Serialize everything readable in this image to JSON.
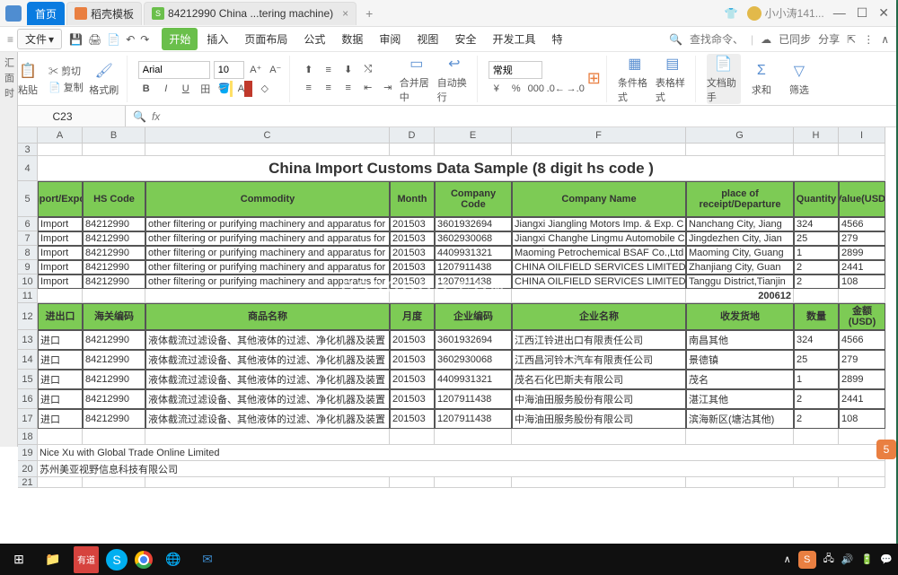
{
  "titlebar": {
    "home_tab": "首页",
    "template_tab": "稻壳模板",
    "doc_tab": "84212990 China ...tering machine)",
    "user": "小小涛141..."
  },
  "menubar": {
    "file": "文件",
    "tabs": [
      "开始",
      "插入",
      "页面布局",
      "公式",
      "数据",
      "审阅",
      "视图",
      "安全",
      "开发工具",
      "特"
    ],
    "search_ph": "查找命令、搜索模板",
    "synced": "已同步",
    "share": "分享"
  },
  "ribbon": {
    "paste": "粘贴",
    "copy": "复制",
    "brush": "格式刷",
    "cut": "剪切",
    "font": "Arial",
    "size": "10",
    "merge": "合并居中",
    "wrap": "自动换行",
    "numfmt": "常规",
    "cond": "条件格式",
    "cellstyle": "表格样式",
    "asst": "文档助手",
    "sum": "求和",
    "filter": "筛选"
  },
  "formula": {
    "namebox": "C23"
  },
  "sheet": {
    "cols_letters": [
      "A",
      "B",
      "C",
      "D",
      "E",
      "F",
      "G",
      "H",
      "I"
    ],
    "title": "China Import Customs Data Sample (8 digit hs code )",
    "headers_en": [
      "Import/Export",
      "HS Code",
      "Commodity",
      "Month",
      "Company Code",
      "Company Name",
      "place of receipt/Departure",
      "Quantity",
      "Value(USD)"
    ],
    "headers_cn": [
      "进出口",
      "海关编码",
      "商品名称",
      "月度",
      "企业编码",
      "企业名称",
      "收发货地",
      "数量",
      "金额(USD)"
    ],
    "rows_en": [
      [
        "Import",
        "84212990",
        "other filtering or purifying machinery and apparatus for liq",
        "201503",
        "3601932694",
        "Jiangxi Jiangling Motors Imp. & Exp. C",
        "Nanchang City, Jiang",
        "324",
        "4566"
      ],
      [
        "Import",
        "84212990",
        "other filtering or purifying machinery and apparatus for liq",
        "201503",
        "3602930068",
        "Jiangxi Changhe Lingmu Automobile C",
        "Jingdezhen City, Jian",
        "25",
        "279"
      ],
      [
        "Import",
        "84212990",
        "other filtering or purifying machinery and apparatus for liq",
        "201503",
        "4409931321",
        "Maoming Petrochemical BSAF Co.,Ltd",
        "Maoming City, Guang",
        "1",
        "2899"
      ],
      [
        "Import",
        "84212990",
        "other filtering or purifying machinery and apparatus for liq",
        "201503",
        "1207911438",
        "CHINA OILFIELD SERVICES LIMITED",
        "Zhanjiang City, Guan",
        "2",
        "2441"
      ],
      [
        "Import",
        "84212990",
        "other filtering or purifying machinery and apparatus for liq",
        "201503",
        "1207911438",
        "CHINA OILFIELD SERVICES LIMITED",
        "Tanggu District,Tianjin",
        "2",
        "108"
      ]
    ],
    "extra_g11": "200612",
    "rows_cn": [
      [
        "进口",
        "84212990",
        "液体截流过滤设备、其他液体的过滤、净化机器及装置",
        "201503",
        "3601932694",
        "江西江铃进出口有限责任公司",
        "南昌其他",
        "324",
        "4566"
      ],
      [
        "进口",
        "84212990",
        "液体截流过滤设备、其他液体的过滤、净化机器及装置",
        "201503",
        "3602930068",
        "江西昌河铃木汽车有限责任公司",
        "景德镇",
        "25",
        "279"
      ],
      [
        "进口",
        "84212990",
        "液体截流过滤设备、其他液体的过滤、净化机器及装置",
        "201503",
        "4409931321",
        "茂名石化巴斯夫有限公司",
        "茂名",
        "1",
        "2899"
      ],
      [
        "进口",
        "84212990",
        "液体截流过滤设备、其他液体的过滤、净化机器及装置",
        "201503",
        "1207911438",
        "中海油田服务股份有限公司",
        "湛江其他",
        "2",
        "2441"
      ],
      [
        "进口",
        "84212990",
        "液体截流过滤设备、其他液体的过滤、净化机器及装置",
        "201503",
        "1207911438",
        "中海油田服务股份有限公司",
        "滨海新区(塘沽其他)",
        "2",
        "108"
      ]
    ],
    "footer1": "Nice Xu with Global Trade Online Limited",
    "footer2": "苏州美亚视野信息科技有限公司"
  },
  "chart_data": {
    "type": "table",
    "title": "China Import Customs Data Sample (8 digit hs code )",
    "columns": [
      "Import/Export",
      "HS Code",
      "Commodity",
      "Month",
      "Company Code",
      "Company Name",
      "place of receipt/Departure",
      "Quantity",
      "Value(USD)"
    ],
    "rows": [
      [
        "Import",
        "84212990",
        "other filtering or purifying machinery and apparatus for liq",
        "201503",
        "3601932694",
        "Jiangxi Jiangling Motors Imp. & Exp. C",
        "Nanchang City, Jiang",
        324,
        4566
      ],
      [
        "Import",
        "84212990",
        "other filtering or purifying machinery and apparatus for liq",
        "201503",
        "3602930068",
        "Jiangxi Changhe Lingmu Automobile C",
        "Jingdezhen City, Jian",
        25,
        279
      ],
      [
        "Import",
        "84212990",
        "other filtering or purifying machinery and apparatus for liq",
        "201503",
        "4409931321",
        "Maoming Petrochemical BSAF Co.,Ltd",
        "Maoming City, Guang",
        1,
        2899
      ],
      [
        "Import",
        "84212990",
        "other filtering or purifying machinery and apparatus for liq",
        "201503",
        "1207911438",
        "CHINA OILFIELD SERVICES LIMITED",
        "Zhanjiang City, Guan",
        2,
        2441
      ],
      [
        "Import",
        "84212990",
        "other filtering or purifying machinery and apparatus for liq",
        "201503",
        "1207911438",
        "CHINA OILFIELD SERVICES LIMITED",
        "Tanggu District,Tianjin",
        2,
        108
      ]
    ]
  }
}
